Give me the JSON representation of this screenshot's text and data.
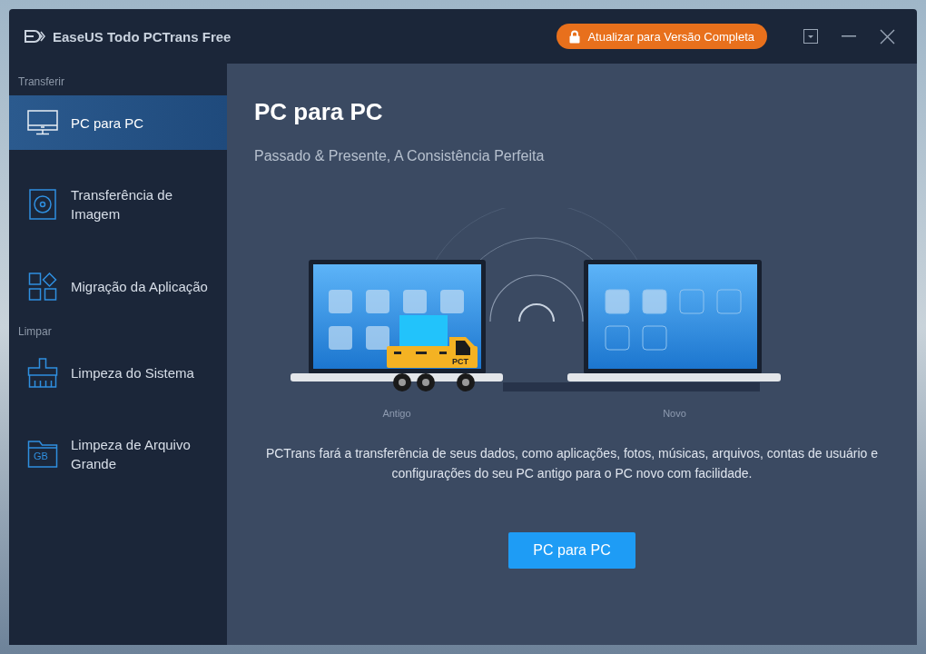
{
  "window": {
    "title": "EaseUS Todo PCTrans Free",
    "upgrade_button": "Atualizar para Versão Completa"
  },
  "sidebar": {
    "sections": [
      {
        "label": "Transferir",
        "items": [
          {
            "kind": "monitor",
            "label": "PC para PC",
            "selected": true
          },
          {
            "kind": "disc",
            "label": "Transferência de Imagem",
            "selected": false
          },
          {
            "kind": "apps",
            "label": "Migração da Aplicação",
            "selected": false
          }
        ]
      },
      {
        "label": "Limpar",
        "items": [
          {
            "kind": "broom",
            "label": "Limpeza do Sistema",
            "selected": false
          },
          {
            "kind": "folder",
            "icon_text": "GB",
            "label": "Limpeza de Arquivo Grande",
            "selected": false
          }
        ]
      }
    ]
  },
  "main": {
    "title": "PC para PC",
    "subtitle": "Passado & Presente, A Consistência Perfeita",
    "illustration": {
      "truck_label": "PCT",
      "old_label": "Antigo",
      "new_label": "Novo"
    },
    "description": "PCTrans fará a transferência de seus dados, como aplicações, fotos, músicas, arquivos, contas de usuário e configurações do seu PC antigo para o PC novo com facilidade.",
    "button": "PC para PC"
  }
}
